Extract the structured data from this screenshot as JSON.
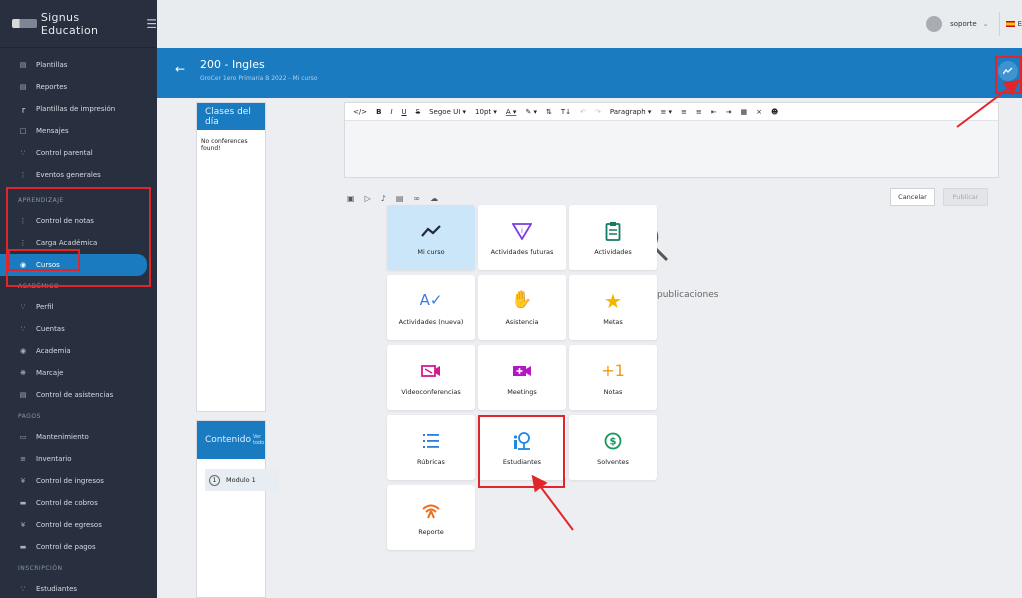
{
  "brand": {
    "name": "Signus Education"
  },
  "sidebar": {
    "items_top": [
      {
        "label": "Plantillas",
        "icon": "template-icon"
      },
      {
        "label": "Reportes",
        "icon": "report-icon"
      },
      {
        "label": "Plantillas de impresión",
        "icon": "print-template-icon"
      },
      {
        "label": "Mensajes",
        "icon": "message-icon"
      },
      {
        "label": "Control parental",
        "icon": "parental-icon"
      },
      {
        "label": "Eventos generales",
        "icon": "events-icon"
      }
    ],
    "section_aprendizaje": "APRENDIZAJE",
    "items_aprendizaje": [
      {
        "label": "Control de notas",
        "icon": "grades-icon"
      },
      {
        "label": "Carga Académica",
        "icon": "load-icon"
      },
      {
        "label": "Cursos",
        "icon": "courses-icon"
      }
    ],
    "section_academico": "ACADÉMICO",
    "items_academico": [
      {
        "label": "Perfil",
        "icon": "profile-icon"
      },
      {
        "label": "Cuentas",
        "icon": "accounts-icon"
      },
      {
        "label": "Academia",
        "icon": "academy-icon"
      },
      {
        "label": "Marcaje",
        "icon": "marking-icon"
      },
      {
        "label": "Control de asistencias",
        "icon": "attendance-icon"
      }
    ],
    "section_pagos": "PAGOS",
    "items_pagos": [
      {
        "label": "Mantenimiento",
        "icon": "maintenance-icon"
      },
      {
        "label": "Inventario",
        "icon": "inventory-icon"
      },
      {
        "label": "Control de ingresos",
        "icon": "income-icon"
      },
      {
        "label": "Control de cobros",
        "icon": "collections-icon"
      },
      {
        "label": "Control de egresos",
        "icon": "expenses-icon"
      },
      {
        "label": "Control de pagos",
        "icon": "payments-icon"
      }
    ],
    "section_inscripcion": "INSCRIPCIÓN",
    "items_inscripcion": [
      {
        "label": "Estudiantes",
        "icon": "students-icon"
      }
    ]
  },
  "topbar": {
    "user": "soporte",
    "lang": "E"
  },
  "header": {
    "title": "200 - Ingles",
    "subtitle": "GroCer 1ero Primaria B 2022 - Mi curso"
  },
  "clases": {
    "title": "Clases del día",
    "empty": "No conferences found!"
  },
  "contenido": {
    "title": "Contenido",
    "sup": "Ver todo",
    "module_num": "1",
    "module_label": "Modulo 1"
  },
  "editor": {
    "font": "Segoe UI",
    "size": "10pt",
    "format": "Paragraph",
    "cancel": "Cancelar",
    "publish": "Publicar"
  },
  "background": {
    "text": "publicaciones"
  },
  "tiles": [
    {
      "label": "Mi curso",
      "icon": "line-chart-icon",
      "color": "#1f2b3a"
    },
    {
      "label": "Actividades futuras",
      "icon": "future-activity-icon",
      "color": "#7b3fe4"
    },
    {
      "label": "Actividades",
      "icon": "clipboard-icon",
      "color": "#137a63"
    },
    {
      "label": "Actividades (nueva)",
      "icon": "spellcheck-icon",
      "color": "#3b7be0"
    },
    {
      "label": "Asistencia",
      "icon": "hand-icon",
      "color": "#f06a13"
    },
    {
      "label": "Metas",
      "icon": "star-icon",
      "color": "#f5b400"
    },
    {
      "label": "Videoconferencias",
      "icon": "video-icon",
      "color": "#d6188f"
    },
    {
      "label": "Meetings",
      "icon": "video-add-icon",
      "color": "#b517c7"
    },
    {
      "label": "Notas",
      "icon": "plus-one-icon",
      "color": "#f39a12"
    },
    {
      "label": "Rúbricas",
      "icon": "list-icon",
      "color": "#2b7fd6"
    },
    {
      "label": "Estudiantes",
      "icon": "student-icon",
      "color": "#1e88e5"
    },
    {
      "label": "Solventes",
      "icon": "dollar-icon",
      "color": "#14995a"
    },
    {
      "label": "Reporte",
      "icon": "wifi-report-icon",
      "color": "#f06a13"
    }
  ]
}
